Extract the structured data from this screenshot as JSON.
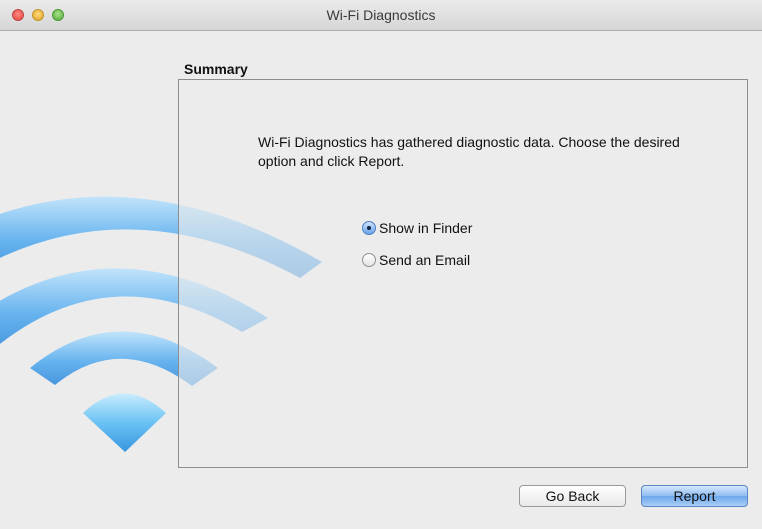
{
  "window": {
    "title": "Wi-Fi Diagnostics",
    "controls": [
      "close",
      "minimize",
      "zoom"
    ]
  },
  "summary": {
    "heading": "Summary",
    "message": "Wi-Fi Diagnostics has gathered diagnostic data. Choose the desired option and click Report.",
    "options": [
      {
        "label": "Show in Finder",
        "selected": true
      },
      {
        "label": "Send an Email",
        "selected": false
      }
    ]
  },
  "buttons": {
    "back": "Go Back",
    "report": "Report"
  },
  "colors": {
    "accent": "#6da7ec",
    "wifi_blue": "#5aaef0",
    "window_bg": "#ececec"
  },
  "icons": [
    "wifi-logo-icon"
  ]
}
